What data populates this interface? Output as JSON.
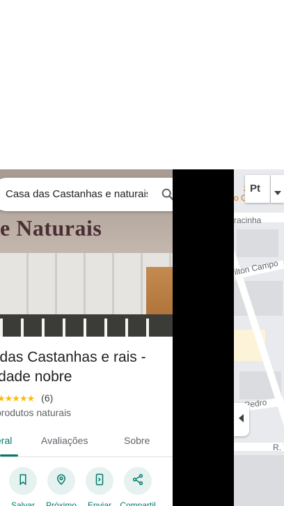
{
  "search": {
    "query": "Casa das Castanhas e naturais"
  },
  "photo": {
    "sign_text": "e Naturais"
  },
  "place": {
    "title": "a das Castanhas e rais - cidade nobre",
    "rating_stars": "★★★★★",
    "review_count": "(6)",
    "category": "produtos naturais"
  },
  "tabs": [
    {
      "label": "eral",
      "active": true
    },
    {
      "label": "Avaliações",
      "active": false
    },
    {
      "label": "Sobre",
      "active": false
    }
  ],
  "actions": [
    {
      "label": "Salvar",
      "icon": "bookmark-icon"
    },
    {
      "label": "Próximo",
      "icon": "nearby-icon"
    },
    {
      "label": "Enviar",
      "icon": "send-to-phone-icon"
    },
    {
      "label": "Compartil",
      "icon": "share-icon"
    }
  ],
  "map": {
    "streets": [
      "racinha",
      "ilton Campo",
      "m Pedro",
      "R. V"
    ],
    "poi_fragment": "zz",
    "poi_fragment2": "o C",
    "layer_button_label": "Pt"
  },
  "colors": {
    "accent": "#00796b",
    "star": "#fbbc04"
  }
}
